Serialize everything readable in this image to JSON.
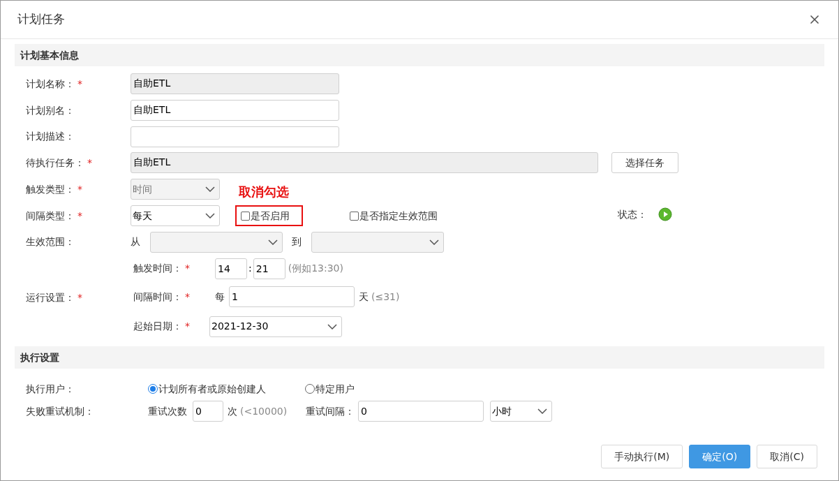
{
  "dialog": {
    "title": "计划任务"
  },
  "basic_section": {
    "title": "计划基本信息",
    "name": {
      "label": "计划名称：",
      "mark": "*",
      "value": "自助ETL",
      "readonly": true
    },
    "alias": {
      "label": "计划别名：",
      "value": "自助ETL",
      "readonly": false
    },
    "description": {
      "label": "计划描述：",
      "readonly": false
    },
    "task": {
      "label": "待执行任务：",
      "mark": "*",
      "value": "自助ETL",
      "readonly": true,
      "button": "选择任务"
    },
    "trigger_type": {
      "label": "触发类型：",
      "mark": "*",
      "value": "时间",
      "disabled": true
    },
    "annotation": "取消勾选",
    "interval_type": {
      "label": "间隔类型：",
      "mark": "*",
      "value": "每天",
      "disabled": false
    },
    "enabled_checkbox": {
      "label": "是否启用",
      "checked": false,
      "highlighted": true
    },
    "range_checkbox": {
      "label": "是否指定生效范围",
      "checked": false
    },
    "status": {
      "label": "状态："
    },
    "effective_range": {
      "label": "生效范围：",
      "from_label": "从",
      "to_label": "到"
    },
    "run_settings": {
      "label": "运行设置：",
      "mark": "*",
      "trigger_time": {
        "label": "触发时间：",
        "mark": "*",
        "hour": "14",
        "separator": ":",
        "minute": "21",
        "hint": "(例如13:30)"
      },
      "interval_time": {
        "label": "间隔时间：",
        "mark": "*",
        "prefix": "每",
        "value": "1",
        "unit": "天",
        "hint": "(≤31)"
      },
      "start_date": {
        "label": "起始日期：",
        "mark": "*",
        "value": "2021-12-30"
      }
    }
  },
  "exec_section": {
    "title": "执行设置",
    "user": {
      "label": "执行用户：",
      "options": [
        {
          "label": "计划所有者或原始创建人",
          "selected": true
        },
        {
          "label": "特定用户",
          "selected": false
        }
      ]
    },
    "retry": {
      "label": "失败重试机制：",
      "count_label": "重试次数",
      "count": "0",
      "count_unit": "次",
      "count_hint": "(<10000)",
      "interval_label": "重试间隔：",
      "interval": "0",
      "interval_unit": "小时"
    }
  },
  "buttons": [
    {
      "label": "手动执行(M)",
      "primary": false
    },
    {
      "label": "确定(O)",
      "primary": true
    },
    {
      "label": "取消(C)",
      "primary": false
    }
  ]
}
